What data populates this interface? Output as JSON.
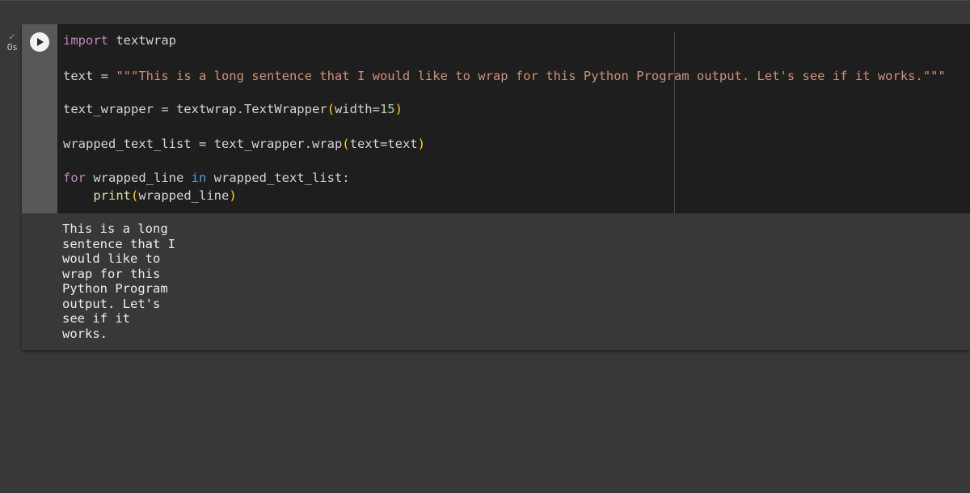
{
  "status": {
    "check": "✓",
    "exec_time": "0s"
  },
  "code": {
    "line1_kw": "import",
    "line1_rest": " textwrap",
    "line2_var": "text = ",
    "line2_str": "\"\"\"This is a long sentence that I would like to wrap for this Python Program output. Let's see if it works.\"\"\"",
    "line3_a": "text_wrapper = textwrap.TextWrapper",
    "line3_open": "(",
    "line3_arg": "width=",
    "line3_num": "15",
    "line3_close": ")",
    "line4_a": "wrapped_text_list = text_wrapper.wrap",
    "line4_open": "(",
    "line4_arg": "text=text",
    "line4_close": ")",
    "line5_for": "for",
    "line5_mid": " wrapped_line ",
    "line5_in": "in",
    "line5_rest": " wrapped_text_list:",
    "line6_indent": "    ",
    "line6_func": "print",
    "line6_open": "(",
    "line6_arg": "wrapped_line",
    "line6_close": ")"
  },
  "output": {
    "lines": [
      "This is a long",
      "sentence that I",
      "would like to",
      "wrap for this",
      "Python Program",
      "output. Let's",
      "see if it",
      "works."
    ]
  }
}
